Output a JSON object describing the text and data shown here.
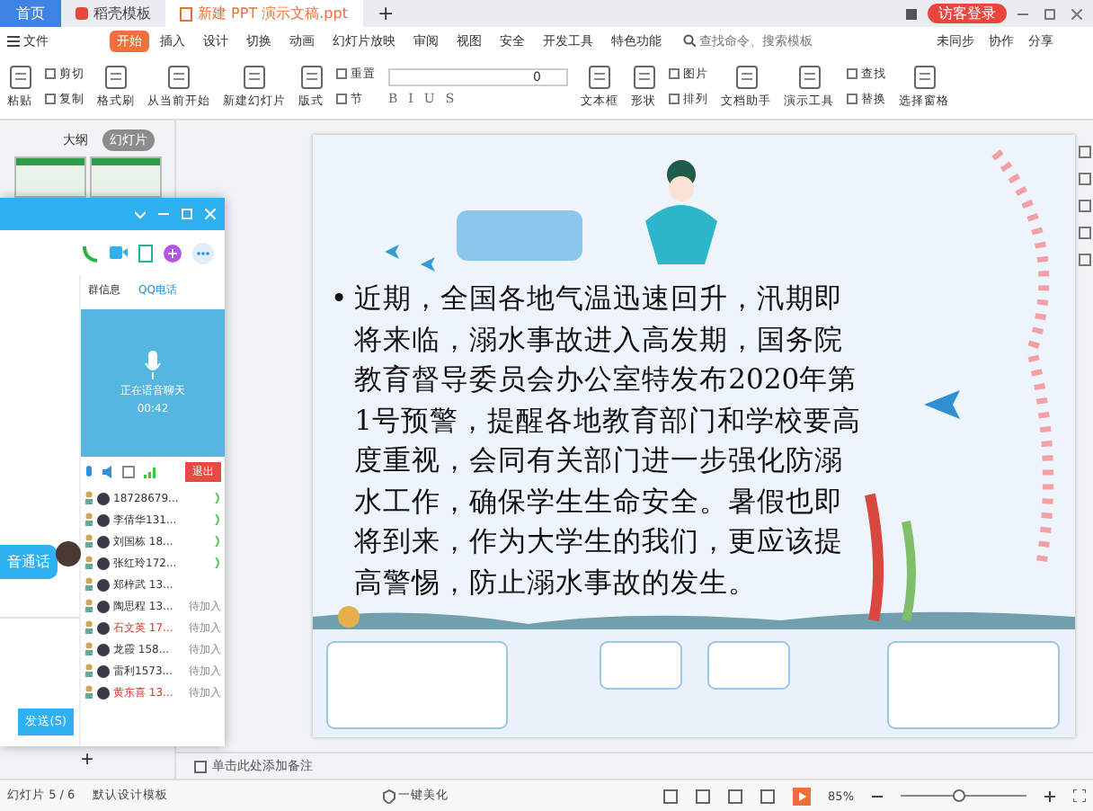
{
  "title_bar": {
    "tabs": [
      {
        "label": "首页",
        "kind": "home",
        "selected": false
      },
      {
        "label": "稻壳模板",
        "kind": "tab",
        "selected": false
      },
      {
        "label": "新建 PPT 演示文稿.ppt",
        "kind": "doc",
        "selected": true
      }
    ],
    "new_tab": "+",
    "login": "访客登录"
  },
  "menu": {
    "file": "文件",
    "tabs": [
      {
        "label": "开始",
        "selected": true
      },
      {
        "label": "插入",
        "selected": false
      },
      {
        "label": "设计",
        "selected": false
      },
      {
        "label": "切换",
        "selected": false
      },
      {
        "label": "动画",
        "selected": false
      },
      {
        "label": "幻灯片放映",
        "selected": false
      },
      {
        "label": "审阅",
        "selected": false
      },
      {
        "label": "视图",
        "selected": false
      },
      {
        "label": "安全",
        "selected": false
      },
      {
        "label": "开发工具",
        "selected": false
      },
      {
        "label": "特色功能",
        "selected": false
      }
    ],
    "search": {
      "placeholder": "查找命令、搜索模板"
    },
    "actions": [
      "未同步",
      "协作",
      "分享"
    ]
  },
  "toolbar": {
    "groups": [
      {
        "kind": "large",
        "label": "粘贴"
      },
      {
        "kind": "stack",
        "items": [
          "剪切",
          "复制"
        ]
      },
      {
        "kind": "large",
        "label": "格式刷"
      },
      {
        "kind": "large",
        "label": "从当前开始"
      },
      {
        "kind": "large",
        "label": "新建幻灯片"
      },
      {
        "kind": "large",
        "label": "版式"
      },
      {
        "kind": "stack",
        "items": [
          "重置",
          "节"
        ]
      },
      {
        "kind": "font",
        "value": "0",
        "buttons": [
          "B",
          "I",
          "U",
          "S"
        ]
      },
      {
        "kind": "large",
        "label": "文本框"
      },
      {
        "kind": "large",
        "label": "形状"
      },
      {
        "kind": "stack",
        "items": [
          "图片",
          "排列"
        ]
      },
      {
        "kind": "large",
        "label": "文档助手"
      },
      {
        "kind": "large",
        "label": "演示工具"
      },
      {
        "kind": "stack",
        "items": [
          "查找",
          "替换"
        ]
      },
      {
        "kind": "large",
        "label": "选择窗格"
      }
    ]
  },
  "slide_panel": {
    "tabs": [
      {
        "label": "大纲",
        "selected": false
      },
      {
        "label": "幻灯片",
        "selected": true
      }
    ],
    "add_button": "+"
  },
  "qq_window": {
    "tabs": [
      {
        "label": "群信息",
        "selected": false
      },
      {
        "label": "QQ电话",
        "selected": true
      }
    ],
    "call": {
      "status": "正在语音聊天",
      "duration": "00:42",
      "exit_button": "退出"
    },
    "members": [
      {
        "name": "18728679...",
        "speaking": true,
        "color": "#333333"
      },
      {
        "name": "李倩华131...",
        "speaking": true,
        "color": "#333333"
      },
      {
        "name": "刘国栋 18...",
        "speaking": true,
        "color": "#333333"
      },
      {
        "name": "张红玲172...",
        "speaking": true,
        "color": "#333333"
      },
      {
        "name": "郑梓武 13...",
        "speaking": false,
        "color": "#333333"
      },
      {
        "name": "陶思程 13...",
        "status": "待加入",
        "speaking": false,
        "color": "#333333"
      },
      {
        "name": "石文英 17...",
        "status": "待加入",
        "speaking": false,
        "color": "#e0312b"
      },
      {
        "name": "龙霞 158...",
        "status": "待加入",
        "speaking": false,
        "color": "#333333"
      },
      {
        "name": "雷利1573...",
        "status": "待加入",
        "speaking": false,
        "color": "#333333"
      },
      {
        "name": "黄东喜 13...",
        "status": "待加入",
        "speaking": false,
        "color": "#e0312b"
      }
    ],
    "chat_bubble": "音通话",
    "send_button": "发送(S)"
  },
  "slide": {
    "bullet": "•",
    "text": "近期，全国各地气温迅速回升，汛期即将来临，溺水事故进入高发期，国务院教育督导委员会办公室特发布2020年第1号预警，提醒各地教育部门和学校要高度重视，会同有关部门进一步强化防溺水工作，确保学生生命安全。暑假也即将到来，作为大学生的我们，更应该提高警惕，防止溺水事故的发生。"
  },
  "notes": {
    "placeholder": "单击此处添加备注"
  },
  "status_bar": {
    "slide_count": "幻灯片 5 / 6",
    "template": "默认设计模板",
    "beautify": "一键美化",
    "zoom": {
      "reading": "85%",
      "level": 0.45
    }
  }
}
